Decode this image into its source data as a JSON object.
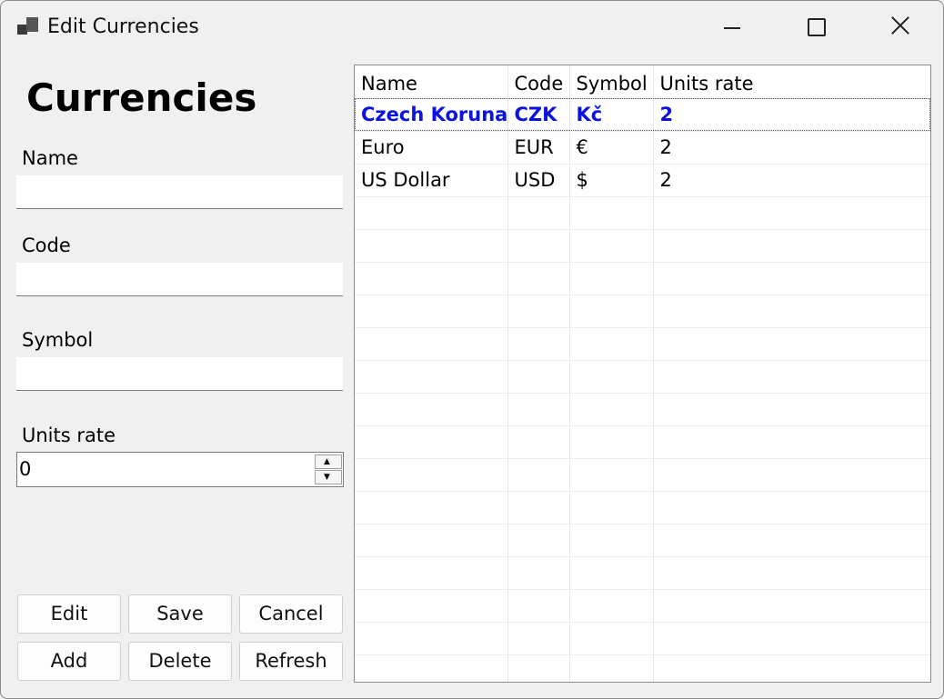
{
  "window": {
    "title": "Edit Currencies"
  },
  "form": {
    "heading": "Currencies",
    "name_label": "Name",
    "name_value": "",
    "code_label": "Code",
    "code_value": "",
    "symbol_label": "Symbol",
    "symbol_value": "",
    "units_rate_label": "Units rate",
    "units_rate_value": "0"
  },
  "buttons": {
    "edit": "Edit",
    "save": "Save",
    "cancel": "Cancel",
    "add": "Add",
    "delete": "Delete",
    "refresh": "Refresh"
  },
  "grid": {
    "columns": [
      "Name",
      "Code",
      "Symbol",
      "Units rate"
    ],
    "rows": [
      [
        "Czech Koruna",
        "CZK",
        "Kč",
        "2"
      ],
      [
        "Euro",
        "EUR",
        "€",
        "2"
      ],
      [
        "US Dollar",
        "USD",
        "$",
        "2"
      ]
    ],
    "selected_row": "Czech Koruna"
  },
  "colors": {
    "selected_text": "#0b13e0",
    "background": "#f0f0f0"
  }
}
